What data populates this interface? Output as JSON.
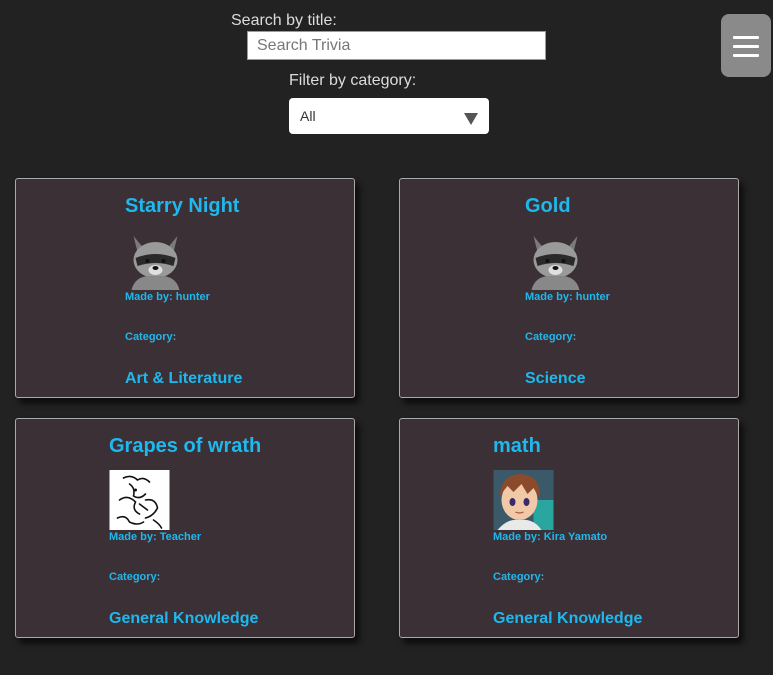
{
  "search": {
    "label": "Search by title:",
    "placeholder": "Search Trivia",
    "value": ""
  },
  "filter": {
    "label": "Filter by category:",
    "selected": "All"
  },
  "menu": {
    "icon": "hamburger-icon"
  },
  "cards": [
    {
      "title": "Starry Night",
      "image": "raccoon-avatar",
      "made_by": "Made by: hunter",
      "category_label": "Category:",
      "category": "Art & Literature"
    },
    {
      "title": "Gold",
      "image": "raccoon-avatar",
      "made_by": "Made by: hunter",
      "category_label": "Category:",
      "category": "Science"
    },
    {
      "title": "Grapes of wrath",
      "image": "sketch-drawing",
      "made_by": "Made by: Teacher",
      "category_label": "Category:",
      "category": "General Knowledge"
    },
    {
      "title": "math",
      "image": "anime-character-avatar",
      "made_by": "Made by: Kira Yamato",
      "category_label": "Category:",
      "category": "General Knowledge"
    }
  ],
  "colors": {
    "background": "#222222",
    "card_background": "#3a3035",
    "accent": "#1fb8ee",
    "menu_button": "#8a8a8a"
  }
}
